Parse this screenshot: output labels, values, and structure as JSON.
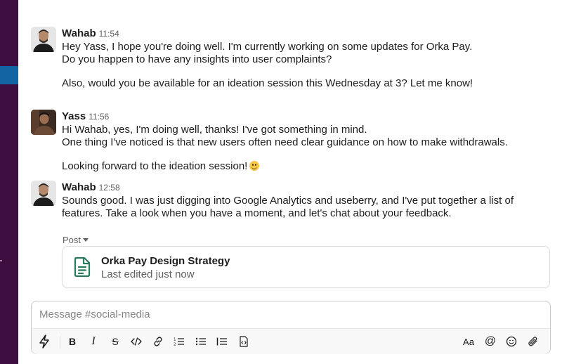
{
  "channel": {
    "composer_placeholder": "Message #social-media"
  },
  "messages": [
    {
      "author": "Wahab",
      "time": "11:54",
      "lines": [
        "Hey Yass, I hope you're doing well. I'm currently working on some updates for Orka Pay.",
        "Do you happen to have any insights into user complaints?",
        "",
        "Also, would you be available for an ideation session this Wednesday at 3? Let me know!"
      ]
    },
    {
      "author": "Yass",
      "time": "11:56",
      "lines": [
        "Hi Wahab, yes, I'm doing well, thanks! I've got something in mind.",
        "One thing I've noticed is that new users often need clear guidance on how to make withdrawals.",
        "",
        "Looking forward to the ideation session!"
      ],
      "emoji": "grinning-face"
    },
    {
      "author": "Wahab",
      "time": "12:58",
      "lines": [
        "Sounds good.  I was just digging into Google Analytics and useberry, and I've put together a list of features. Take a look when you have a moment, and let's chat about your feedback."
      ]
    }
  ],
  "post": {
    "label": "Post",
    "title": "Orka Pay Design Strategy",
    "subtitle": "Last edited just now",
    "icon": "document-icon",
    "icon_color": "#2b7a5e"
  },
  "toolbar": {
    "icons": [
      "shortcuts-lightning-icon",
      "bold-icon",
      "italic-icon",
      "strikethrough-icon",
      "code-icon",
      "link-icon",
      "ordered-list-icon",
      "bulleted-list-icon",
      "blockquote-icon",
      "code-block-icon",
      "formatting-icon",
      "mention-icon",
      "emoji-icon",
      "attachment-icon"
    ],
    "bold": "B",
    "italic": "I",
    "strike": "S",
    "format": "Aa",
    "mention": "@"
  },
  "colors": {
    "sidebar": "#3f0e40",
    "sidebar_active": "#1264a3",
    "text": "#1d1c1d",
    "muted": "#616061"
  }
}
